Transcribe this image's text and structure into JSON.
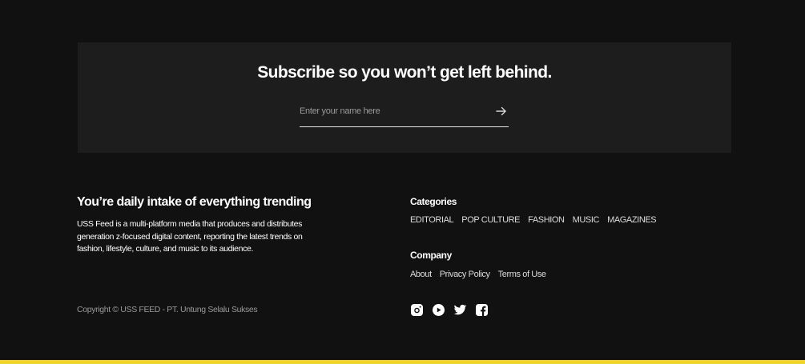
{
  "colors": {
    "background": "#111111",
    "panel": "#1d1d1d",
    "accent_bar": "#f3d128"
  },
  "subscribe": {
    "title": "Subscribe so you won’t get left behind.",
    "placeholder": "Enter your name here",
    "submit_icon": "arrow-right-icon"
  },
  "about": {
    "heading": "You’re daily intake of everything trending",
    "description": "USS Feed is a multi-platform media that produces and distributes generation z-focused digital content, reporting the latest trends on fashion, lifestyle, culture, and music to its audience."
  },
  "categories": {
    "title": "Categories",
    "items": [
      "EDITORIAL",
      "POP CULTURE",
      "FASHION",
      "MUSIC",
      "MAGAZINES"
    ]
  },
  "company": {
    "title": "Company",
    "items": [
      "About",
      "Privacy Policy",
      "Terms of Use"
    ]
  },
  "copyright": "Copyright © USS FEED - PT. Untung Selalu Sukses",
  "social_icons": [
    "instagram-icon",
    "youtube-icon",
    "twitter-icon",
    "facebook-icon"
  ]
}
